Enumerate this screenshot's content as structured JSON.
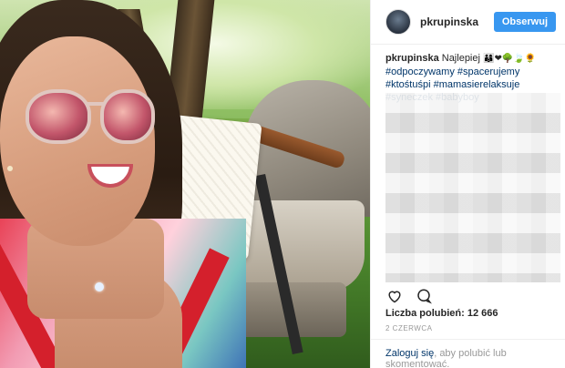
{
  "post": {
    "username": "pkrupinska",
    "follow_label": "Obserwuj",
    "caption": {
      "user": "pkrupinska",
      "text": "Najlepiej",
      "emojis": "👨‍👩‍👦❤🌳🍃🌻",
      "hashtags": "#odpoczywamy #spacerujemy #ktośtuśpi #mamasierelaksuje #syneczek #babyboy"
    },
    "likes": "Liczba polubień: 12 666",
    "date": "2 CZERWCA",
    "footer": {
      "login": "Zaloguj się",
      "rest": ", aby polubić lub skomentować."
    }
  },
  "icons": {
    "like": "heart-icon",
    "comment": "comment-icon"
  },
  "colors": {
    "follow_button": "#3897f0",
    "hashtag": "#003569"
  }
}
